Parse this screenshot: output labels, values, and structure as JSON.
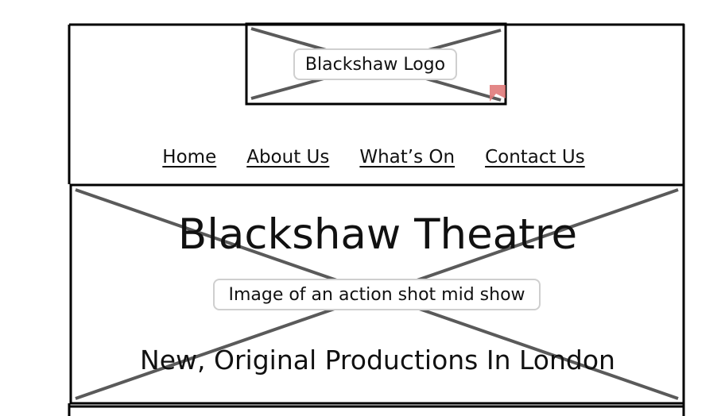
{
  "header": {
    "logo_placeholder_label": "Blackshaw Logo"
  },
  "nav": {
    "items": [
      {
        "label": "Home"
      },
      {
        "label": "About Us"
      },
      {
        "label": "What’s On"
      },
      {
        "label": "Contact Us"
      }
    ]
  },
  "hero": {
    "title": "Blackshaw Theatre",
    "image_placeholder_label": "Image of an action shot mid show",
    "tagline": "New, Original Productions In London"
  },
  "colors": {
    "stroke": "#000000",
    "placeholder_cross": "#5a5a5a",
    "label_border": "#cfcfcf",
    "corner_marker": "#e07a7a"
  }
}
